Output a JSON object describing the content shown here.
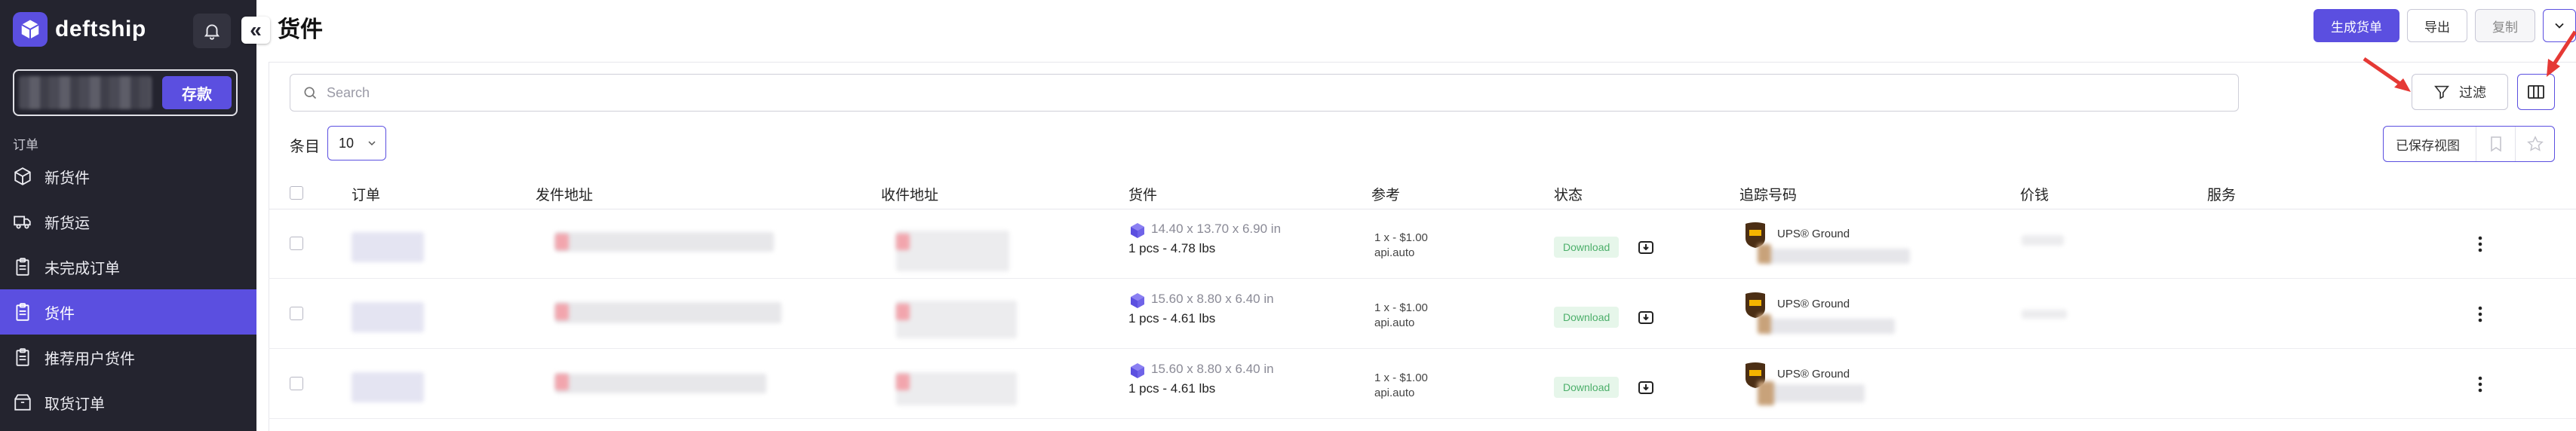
{
  "app": {
    "name": "deftship",
    "collapse_glyph": "«",
    "brand_color": "#5b4fe0",
    "sidebar_bg": "#24242f"
  },
  "sidebar": {
    "deposit_label": "存款",
    "section_label": "订单",
    "items": [
      {
        "label": "新货件",
        "icon": "package-icon",
        "active": false
      },
      {
        "label": "新货运",
        "icon": "truck-icon",
        "active": false
      },
      {
        "label": "未完成订单",
        "icon": "clipboard-icon",
        "active": false
      },
      {
        "label": "货件",
        "icon": "clipboard-icon",
        "active": true
      },
      {
        "label": "推荐用户货件",
        "icon": "clipboard-icon",
        "active": false
      },
      {
        "label": "取货订单",
        "icon": "pickup-box-icon",
        "active": false
      }
    ]
  },
  "header": {
    "title": "货件",
    "create_label": "生成货单",
    "export_label": "导出",
    "copy_label": "复制"
  },
  "toolbar": {
    "search_placeholder": "Search",
    "filter_label": "过滤",
    "entries_label": "条目",
    "entries_value": "10",
    "saved_views_label": "已保存视图"
  },
  "table": {
    "columns": [
      "订单",
      "发件地址",
      "收件地址",
      "货件",
      "参考",
      "状态",
      "追踪号码",
      "价钱",
      "服务"
    ],
    "rows": [
      {
        "dims": "14.40 x 13.70 x 6.90 in",
        "count": "1 pcs - 4.78 lbs",
        "ref_line1": "1 x - $1.00",
        "ref_line2": "api.auto",
        "status": "Download",
        "carrier": "UPS® Ground"
      },
      {
        "dims": "15.60 x 8.80 x 6.40 in",
        "count": "1 pcs - 4.61 lbs",
        "ref_line1": "1 x - $1.00",
        "ref_line2": "api.auto",
        "status": "Download",
        "carrier": "UPS® Ground"
      },
      {
        "dims": "15.60 x 8.80 x 6.40 in",
        "count": "1 pcs - 4.61 lbs",
        "ref_line1": "1 x - $1.00",
        "ref_line2": "api.auto",
        "status": "Download",
        "carrier": "UPS® Ground"
      }
    ]
  }
}
